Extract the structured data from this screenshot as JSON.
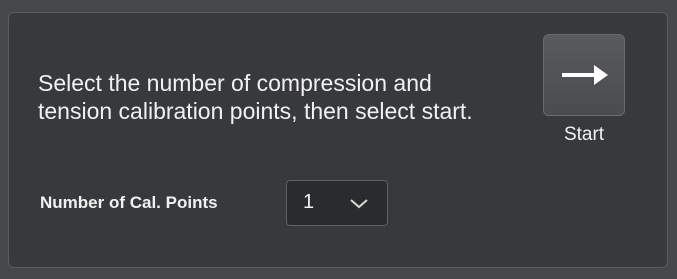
{
  "panel": {
    "instruction": "Select the number of compression and tension calibration points, then select start.",
    "start_button": {
      "label": "Start",
      "icon": "arrow-right-icon"
    },
    "cal_points": {
      "label": "Number of Cal. Points",
      "value": "1",
      "icon": "chevron-down-icon"
    }
  },
  "colors": {
    "background": "#38393c",
    "text": "#f1f1f1",
    "button": "#525357"
  }
}
